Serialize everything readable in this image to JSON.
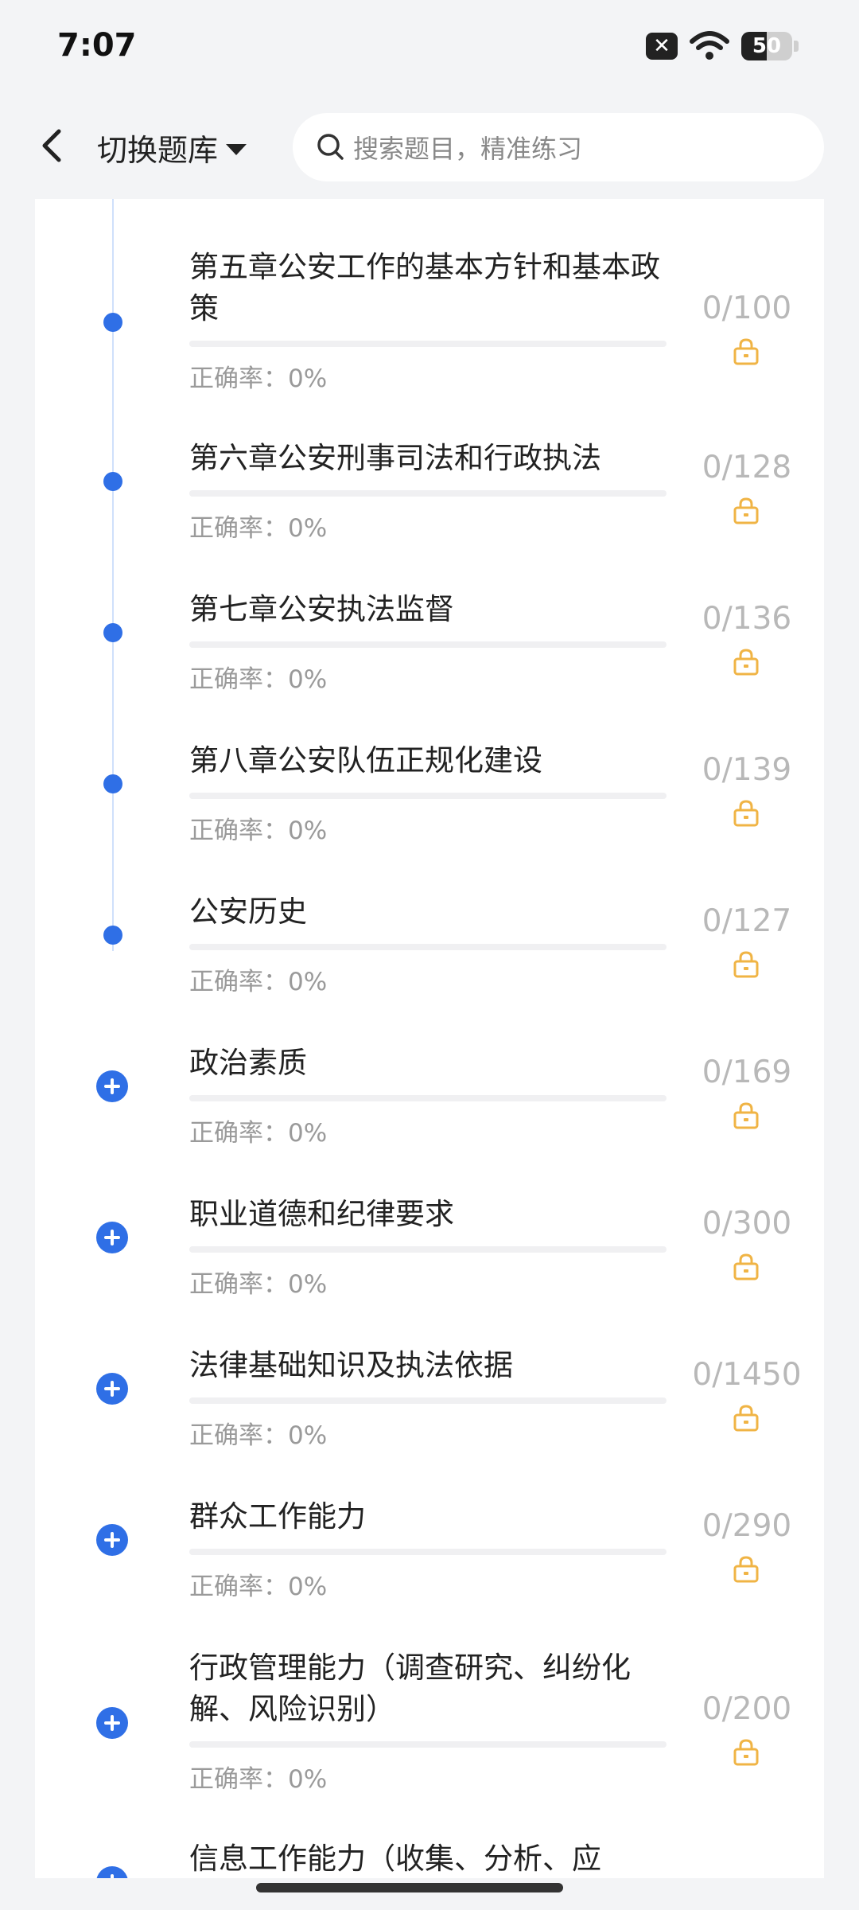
{
  "status_bar": {
    "time": "7:07",
    "battery": "50",
    "battery_level": 0.5
  },
  "header": {
    "switch_label": "切换题库",
    "search_placeholder": "搜索题目，精准练习"
  },
  "items": [
    {
      "title": "第五章公安工作的基本方针和基本政策",
      "rate": "正确率：0%",
      "count": "0/100",
      "expandable": false
    },
    {
      "title": "第六章公安刑事司法和行政执法",
      "rate": "正确率：0%",
      "count": "0/128",
      "expandable": false
    },
    {
      "title": "第七章公安执法监督",
      "rate": "正确率：0%",
      "count": "0/136",
      "expandable": false
    },
    {
      "title": "第八章公安队伍正规化建设",
      "rate": "正确率：0%",
      "count": "0/139",
      "expandable": false
    },
    {
      "title": "公安历史",
      "rate": "正确率：0%",
      "count": "0/127",
      "expandable": false
    },
    {
      "title": "政治素质",
      "rate": "正确率：0%",
      "count": "0/169",
      "expandable": true
    },
    {
      "title": "职业道德和纪律要求",
      "rate": "正确率：0%",
      "count": "0/300",
      "expandable": true
    },
    {
      "title": "法律基础知识及执法依据",
      "rate": "正确率：0%",
      "count": "0/1450",
      "expandable": true
    },
    {
      "title": "群众工作能力",
      "rate": "正确率：0%",
      "count": "0/290",
      "expandable": true
    },
    {
      "title": "行政管理能力（调查研究、纠纷化解、风险识别）",
      "rate": "正确率：0%",
      "count": "0/200",
      "expandable": true
    },
    {
      "title": "信息工作能力（收集、分析、应",
      "rate": "",
      "count": "",
      "expandable": true
    }
  ],
  "colors": {
    "accent": "#2f6fe6",
    "lock": "#f0b445"
  }
}
